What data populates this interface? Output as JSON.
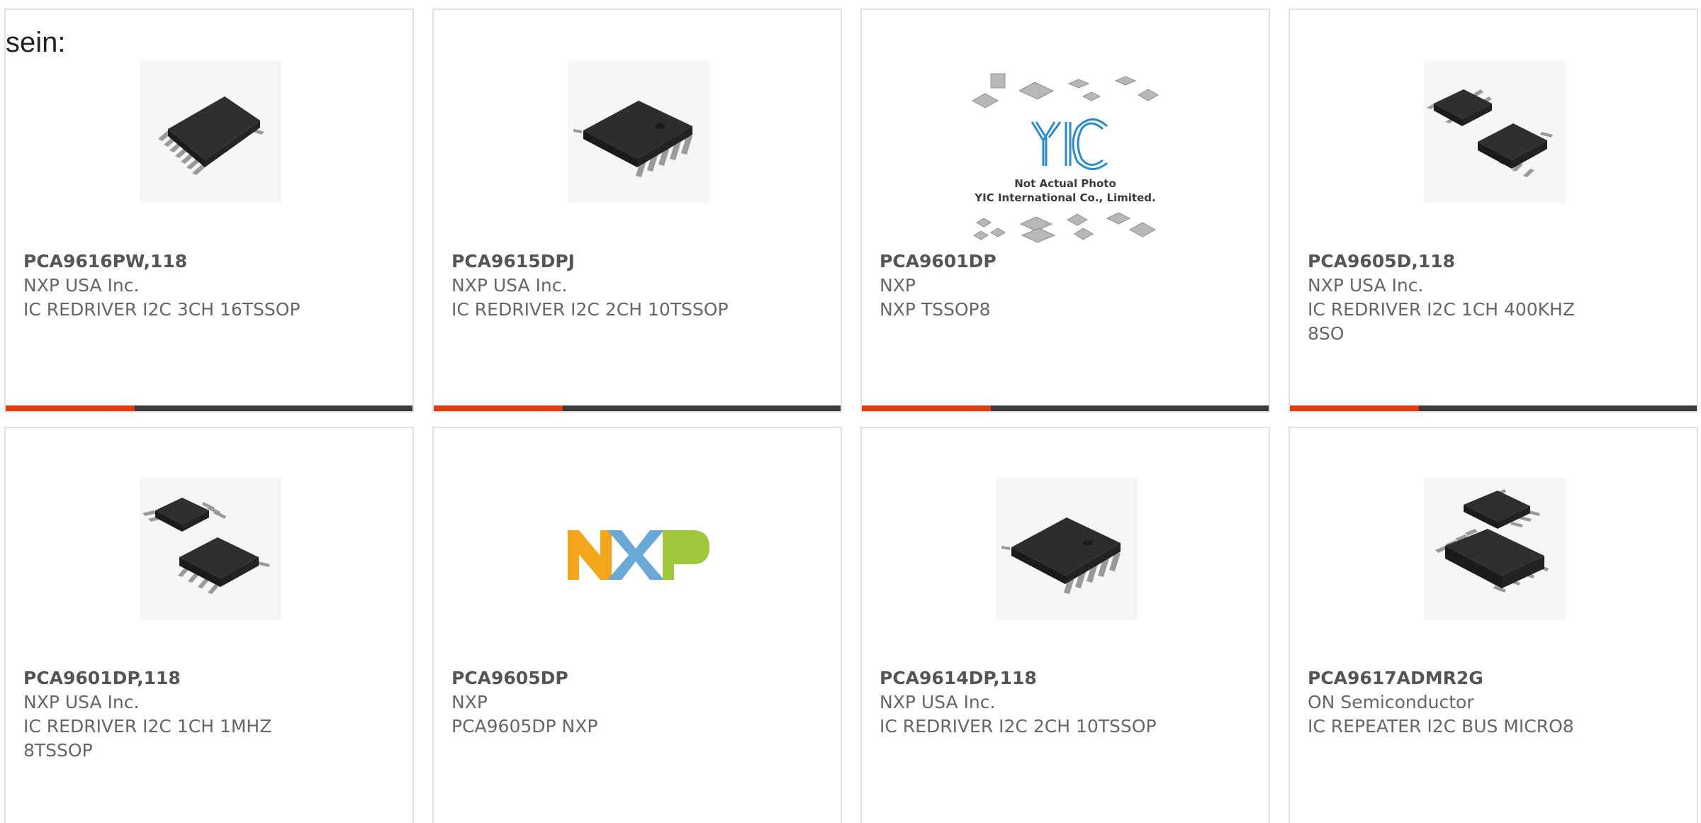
{
  "intro_text": "sein:",
  "colors": {
    "accent": "#e03e12",
    "bar": "#3b3b3b",
    "border": "#e1e1e1"
  },
  "products": [
    {
      "part_number": "PCA9616PW,118",
      "manufacturer": "NXP USA Inc.",
      "description": "IC REDRIVER I2C 3CH 16TSSOP",
      "image": "tssop16-chip-icon"
    },
    {
      "part_number": "PCA9615DPJ",
      "manufacturer": "NXP USA Inc.",
      "description": "IC REDRIVER I2C 2CH 10TSSOP",
      "image": "tssop10-chip-icon"
    },
    {
      "part_number": "PCA9601DP",
      "manufacturer": "NXP",
      "description": "NXP TSSOP8",
      "image": "yic-not-actual-photo-placeholder",
      "placeholder_caption_1": "Not Actual Photo",
      "placeholder_caption_2": "YIC International Co., Limited."
    },
    {
      "part_number": "PCA9605D,118",
      "manufacturer": "NXP USA Inc.",
      "description": "IC REDRIVER I2C 1CH 400KHZ 8SO",
      "image": "so8-chips-icon"
    },
    {
      "part_number": "PCA9601DP,118",
      "manufacturer": "NXP USA Inc.",
      "description": "IC REDRIVER I2C 1CH 1MHZ 8TSSOP",
      "image": "tssop8-chips-icon"
    },
    {
      "part_number": "PCA9605DP",
      "manufacturer": "NXP",
      "description": "PCA9605DP NXP",
      "image": "nxp-logo",
      "logo_text": "NXP"
    },
    {
      "part_number": "PCA9614DP,118",
      "manufacturer": "NXP USA Inc.",
      "description": "IC REDRIVER I2C 2CH 10TSSOP",
      "image": "tssop10-chip-icon"
    },
    {
      "part_number": "PCA9617ADMR2G",
      "manufacturer": "ON Semiconductor",
      "description": "IC REPEATER I2C BUS MICRO8",
      "image": "micro8-chips-icon"
    }
  ]
}
